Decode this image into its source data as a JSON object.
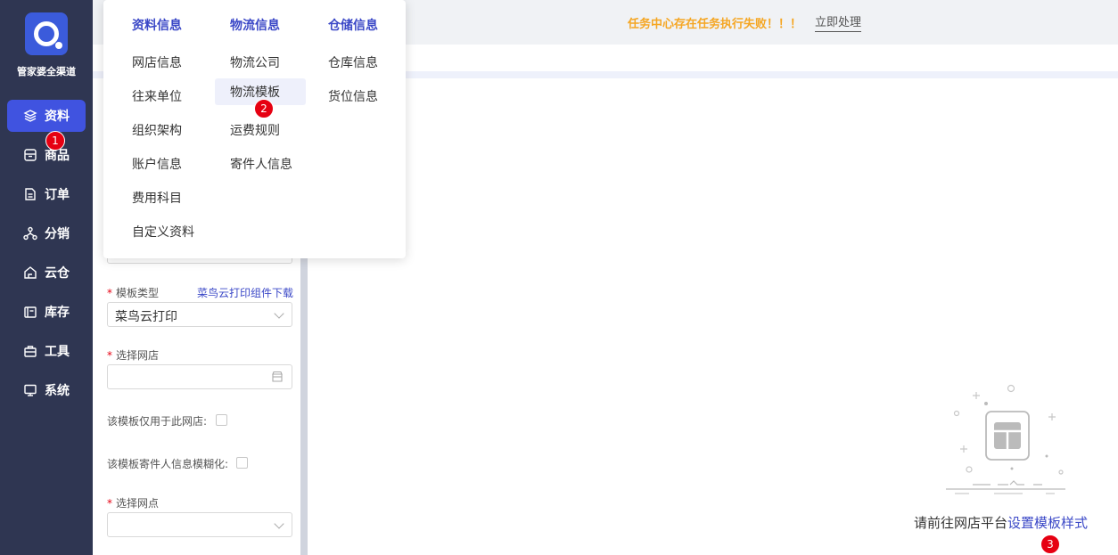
{
  "brand": {
    "name": "管家婆全渠道"
  },
  "sidebar": {
    "items": [
      {
        "label": "资料",
        "icon": "layers-icon",
        "active": true
      },
      {
        "label": "商品",
        "icon": "box-icon",
        "active": false
      },
      {
        "label": "订单",
        "icon": "document-icon",
        "active": false
      },
      {
        "label": "分销",
        "icon": "network-icon",
        "active": false
      },
      {
        "label": "云仓",
        "icon": "cloud-warehouse-icon",
        "active": false
      },
      {
        "label": "库存",
        "icon": "inventory-icon",
        "active": false
      },
      {
        "label": "工具",
        "icon": "toolbox-icon",
        "active": false
      },
      {
        "label": "系统",
        "icon": "monitor-icon",
        "active": false
      }
    ]
  },
  "topbar": {
    "alert": "任务中心存在任务执行失败！！！",
    "action": "立即处理",
    "alert_color": "#f5a623"
  },
  "menu": {
    "columns": [
      {
        "title": "资料信息",
        "items": [
          "网店信息",
          "往来单位",
          "组织架构",
          "账户信息",
          "费用科目",
          "自定义资料"
        ]
      },
      {
        "title": "物流信息",
        "items": [
          "物流公司",
          "物流模板",
          "运费规则",
          "寄件人信息"
        ]
      },
      {
        "title": "仓储信息",
        "items": [
          "仓库信息",
          "货位信息"
        ]
      }
    ],
    "highlighted": "物流模板"
  },
  "form": {
    "template_type_label": "模板类型",
    "template_type_value": "菜鸟云打印",
    "download_link": "菜鸟云打印组件下载",
    "shop_label": "选择网店",
    "shop_only_label": "该模板仅用于此网店:",
    "sender_blur_label": "该模板寄件人信息模糊化:",
    "outlet_label": "选择网点"
  },
  "main": {
    "hint_prefix": "请前往网店平台",
    "hint_link": "设置模板样式"
  },
  "markers": [
    "1",
    "2",
    "3"
  ],
  "colors": {
    "sidebar_bg": "#2f3652",
    "accent": "#4053e0",
    "marker": "#e60012"
  }
}
